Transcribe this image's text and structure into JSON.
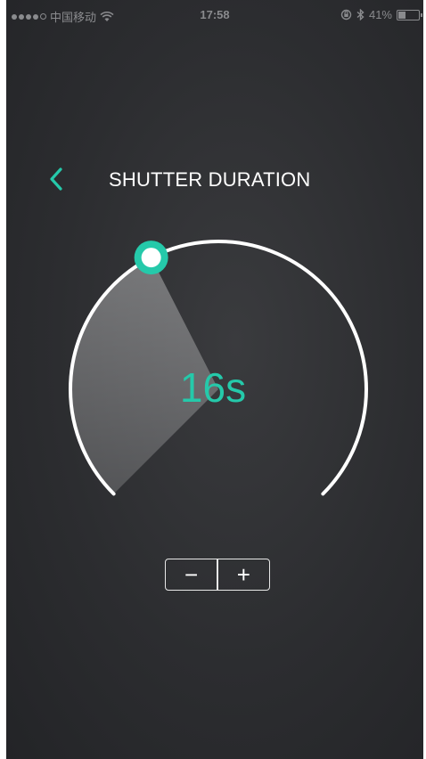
{
  "status_bar": {
    "carrier": "中国移动",
    "time": "17:58",
    "battery_percent": "41%",
    "battery_level": 0.41,
    "icons": [
      "signal-icon",
      "wifi-icon",
      "orientation-lock-icon",
      "bluetooth-icon",
      "battery-icon"
    ]
  },
  "header": {
    "title": "SHUTTER DURATION",
    "back_icon": "chevron-left-icon"
  },
  "dial": {
    "value_label": "16s",
    "level": 0.4,
    "colors": {
      "accent": "#25c9aa",
      "arc": "#ffffff"
    }
  },
  "stepper": {
    "minus_label": "−",
    "plus_label": "+"
  },
  "colors": {
    "background": "#2c2d30",
    "accent": "#25c9aa"
  }
}
